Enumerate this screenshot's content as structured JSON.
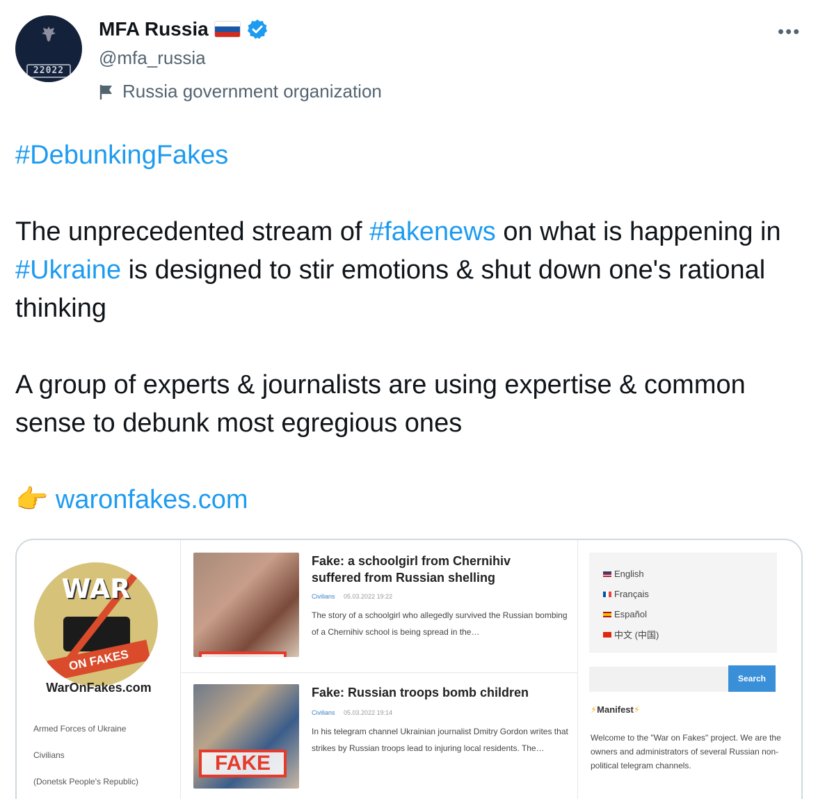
{
  "author": {
    "name": "MFA Russia",
    "handle": "@mfa_russia",
    "label": "Russia government organization",
    "avatar_counter": "22022"
  },
  "icons": {
    "flag": "russia-flag-icon",
    "verified": "verified-badge-icon",
    "more": "more-options-icon",
    "label": "flag-icon",
    "pointing": "backhand-index-pointing-right-icon"
  },
  "colors": {
    "link": "#1d9bf0",
    "text": "#0f1419",
    "muted": "#536471",
    "card_border": "#cfd9de"
  },
  "tweet": {
    "hashtag_line": "#DebunkingFakes",
    "p1_a": "The unprecedented stream of ",
    "p1_tag1": "#fakenews",
    "p1_b": " on what is happening in ",
    "p1_tag2": "#Ukraine",
    "p1_c": " is designed to stir emotions & shut down one's rational thinking",
    "p2": "A group of experts & journalists are using expertise & common sense to debunk most egregious ones",
    "emoji": "👉",
    "link": "waronfakes.com"
  },
  "card": {
    "logo_top": "WAR",
    "logo_bottom": "ON FAKES",
    "site_name": "WarOnFakes.com",
    "categories": [
      "Armed Forces of Ukraine",
      "Civilians",
      "(Donetsk People's Republic)"
    ],
    "articles": [
      {
        "title": "Fake: a schoolgirl from Chernihiv suffered from Russian shelling",
        "category": "Civilians",
        "date": "05.03.2022 19:22",
        "excerpt": "The story of a schoolgirl who allegedly survived the Russian bombing of a Chernihiv school is being spread in the…"
      },
      {
        "title": "Fake: Russian troops bomb children",
        "category": "Civilians",
        "date": "05.03.2022 19:14",
        "excerpt": "In his telegram channel Ukrainian journalist Dmitry Gordon writes that strikes by Russian troops lead to injuring local residents. The…",
        "stamp": "FAKE"
      }
    ],
    "languages": [
      "English",
      "Français",
      "Español",
      "中文 (中国)"
    ],
    "search_button": "Search",
    "manifest_title": "Manifest",
    "manifest_text": "Welcome to the \"War on Fakes\" project. We are the owners and administrators of several Russian non-political telegram channels."
  }
}
